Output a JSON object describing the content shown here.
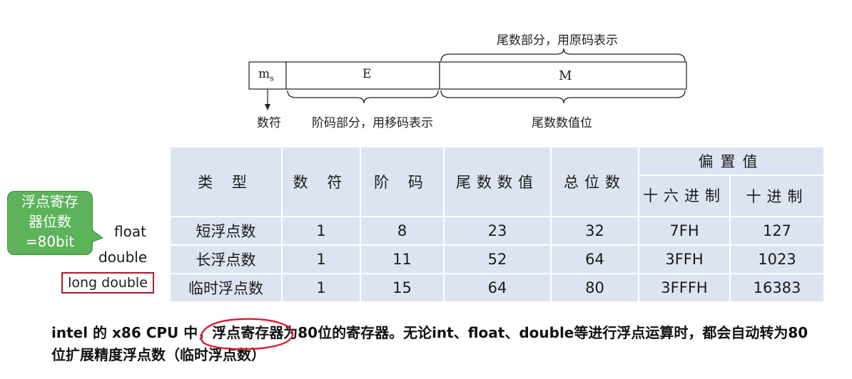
{
  "diagram": {
    "sign_field": {
      "label": "m",
      "subscript": "s",
      "caption": "数符"
    },
    "exponent_field": {
      "label": "E",
      "caption": "阶码部分，用移码表示"
    },
    "mantissa_field": {
      "label": "M",
      "caption": "尾数数值位"
    },
    "mantissa_part_caption": "尾数部分，用原码表示"
  },
  "table": {
    "headers": {
      "type": "类 型",
      "sign": "数 符",
      "exponent": "阶 码",
      "mantissa": "尾数数值",
      "total_bits": "总位数",
      "bias": "偏置值",
      "bias_hex": "十六进制",
      "bias_dec": "十进制"
    },
    "rows": [
      {
        "type": "短浮点数",
        "sign": "1",
        "exponent": "8",
        "mantissa": "23",
        "total": "32",
        "bias_hex": "7FH",
        "bias_dec": "127"
      },
      {
        "type": "长浮点数",
        "sign": "1",
        "exponent": "11",
        "mantissa": "52",
        "total": "64",
        "bias_hex": "3FFH",
        "bias_dec": "1023"
      },
      {
        "type": "临时浮点数",
        "sign": "1",
        "exponent": "15",
        "mantissa": "64",
        "total": "80",
        "bias_hex": "3FFFH",
        "bias_dec": "16383"
      }
    ]
  },
  "side_labels": {
    "float": "float",
    "double": "double",
    "long_double": "long double"
  },
  "callout": {
    "line1": "浮点寄存",
    "line2": "器位数",
    "line3": "=80bit",
    "color": "#5cb35a"
  },
  "note": {
    "part1": "intel 的 x86 CPU 中，",
    "highlight": "浮点寄存器",
    "part2": "为80位的寄存器。无论int、float、double等进行浮点运算时，都会自动转为80位扩展精度浮点数（临时浮点数）"
  },
  "colors": {
    "table_cell": "#dde4f1",
    "highlight_box": "#a61c2e",
    "ellipse": "#d4213a"
  }
}
